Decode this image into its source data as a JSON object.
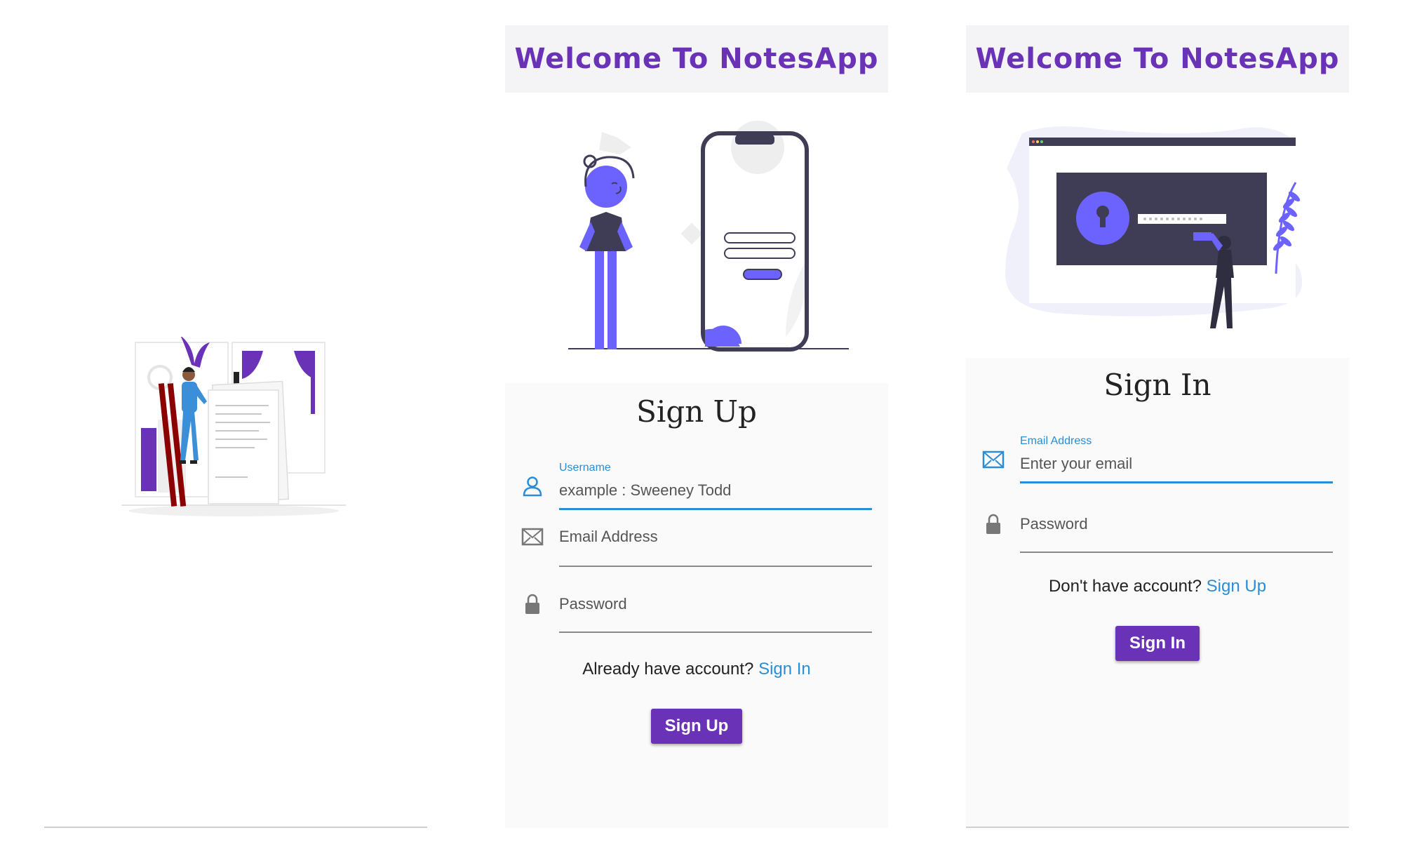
{
  "colors": {
    "accent": "#6a32b6",
    "link": "#2a8dd6",
    "illustration": "#6c63ff",
    "dark": "#3f3d56"
  },
  "splash": {
    "illustration": "notes-illustration"
  },
  "signup": {
    "header_title": "Welcome To NotesApp",
    "form_title": "Sign Up",
    "username": {
      "icon": "person-icon",
      "label": "Username",
      "value": "example : Sweeney Todd"
    },
    "email": {
      "icon": "mail-icon",
      "placeholder": "Email Address"
    },
    "password": {
      "icon": "lock-icon",
      "placeholder": "Password"
    },
    "switch_prompt": "Already have account?",
    "switch_link": "Sign In",
    "button": "Sign Up"
  },
  "signin": {
    "header_title": "Welcome To NotesApp",
    "form_title": "Sign In",
    "email": {
      "icon": "mail-icon",
      "label": "Email Address",
      "value": "Enter your email"
    },
    "password": {
      "icon": "lock-icon",
      "placeholder": "Password"
    },
    "switch_prompt": "Don't have account?",
    "switch_link": "Sign Up",
    "button": "Sign In"
  }
}
